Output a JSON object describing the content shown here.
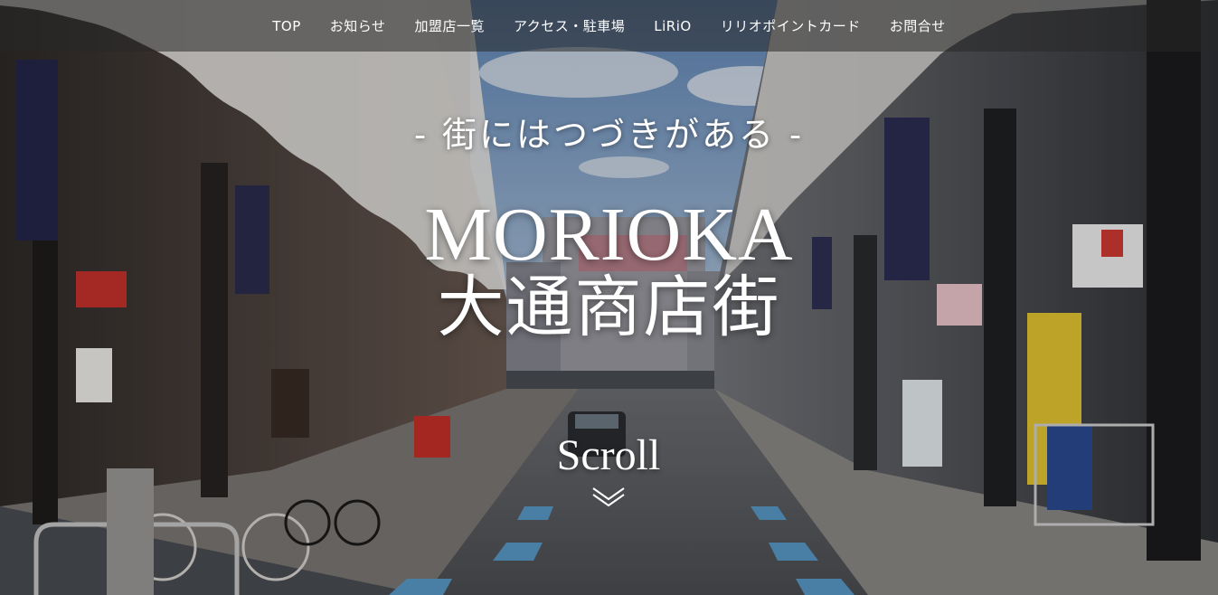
{
  "nav": {
    "items": [
      {
        "label": "TOP"
      },
      {
        "label": "お知らせ"
      },
      {
        "label": "加盟店一覧"
      },
      {
        "label": "アクセス・駐車場"
      },
      {
        "label": "LiRiO"
      },
      {
        "label": "リリオポイントカード"
      },
      {
        "label": "お問合せ"
      }
    ]
  },
  "hero": {
    "tagline": "- 街にはつづきがある -",
    "title_en": "MORIOKA",
    "title_jp": "大通商店街",
    "scroll_label": "Scroll",
    "scroll_icon": "chevron-down-icon"
  },
  "colors": {
    "text": "#ffffff",
    "nav_bg": "rgba(40,40,40,0.55)"
  }
}
